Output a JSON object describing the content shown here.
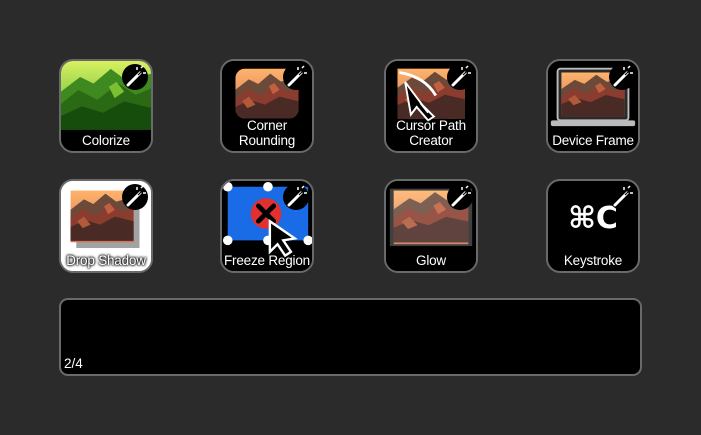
{
  "effects": [
    {
      "label": "Colorize",
      "icon": "colorize-image-icon"
    },
    {
      "label": "Corner\nRounding",
      "icon": "corner-rounding-image-icon"
    },
    {
      "label": "Cursor Path\nCreator",
      "icon": "cursor-path-icon"
    },
    {
      "label": "Device Frame",
      "icon": "laptop-frame-icon"
    },
    {
      "label": "Drop Shadow",
      "icon": "drop-shadow-image-icon"
    },
    {
      "label": "Freeze Region",
      "icon": "freeze-region-icon"
    },
    {
      "label": "Glow",
      "icon": "glow-image-icon"
    },
    {
      "label": "Keystroke",
      "icon": "keystroke-icon"
    }
  ],
  "keystroke_text": "⌘C",
  "badge_icon": "magic-wand-icon",
  "panel": {
    "page_indicator": "2/4"
  },
  "colors": {
    "background": "#2b2b2b",
    "tile_border": "#6a6a6a",
    "freeze_blue": "#1a6be6",
    "freeze_red": "#e03030"
  }
}
